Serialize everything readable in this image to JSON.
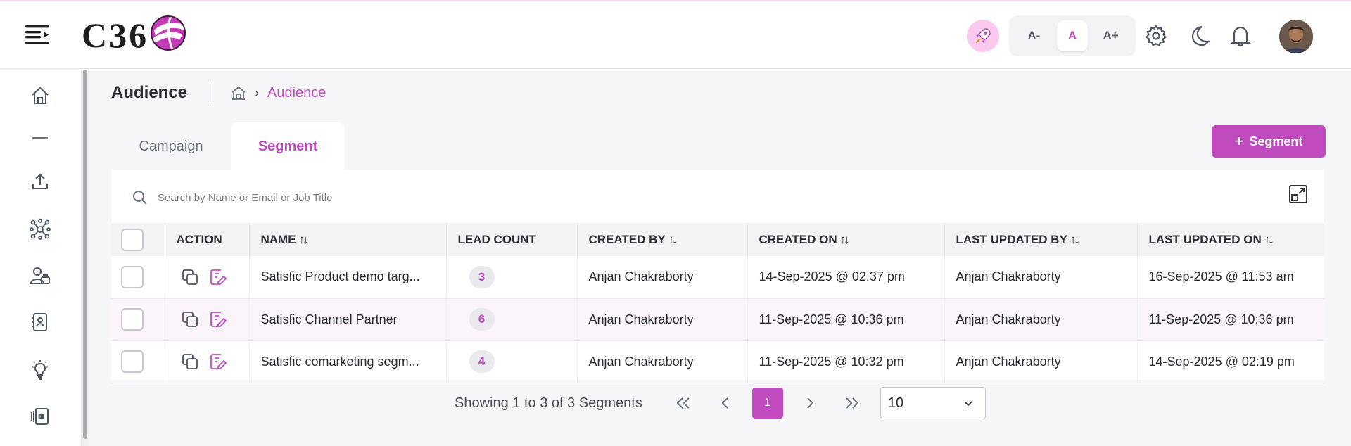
{
  "header": {
    "logo_text": "C36",
    "font_sizes": [
      "A-",
      "A",
      "A+"
    ],
    "active_font_size": "A"
  },
  "page": {
    "title": "Audience",
    "breadcrumb_current": "Audience"
  },
  "tabs": [
    {
      "label": "Campaign",
      "active": false
    },
    {
      "label": "Segment",
      "active": true
    }
  ],
  "add_button_label": "Segment",
  "search": {
    "placeholder": "Search by Name or Email or Job Title"
  },
  "table": {
    "columns": [
      "ACTION",
      "NAME",
      "LEAD COUNT",
      "CREATED BY",
      "CREATED ON",
      "LAST UPDATED BY",
      "LAST UPDATED ON"
    ],
    "rows": [
      {
        "name": "Satisfic Product demo targ...",
        "lead_count": "3",
        "created_by": "Anjan Chakraborty",
        "created_on": "14-Sep-2025 @ 02:37 pm",
        "updated_by": "Anjan Chakraborty",
        "updated_on": "16-Sep-2025 @ 11:53 am"
      },
      {
        "name": "Satisfic Channel Partner",
        "lead_count": "6",
        "created_by": "Anjan Chakraborty",
        "created_on": "11-Sep-2025 @ 10:36 pm",
        "updated_by": "Anjan Chakraborty",
        "updated_on": "11-Sep-2025 @ 10:36 pm"
      },
      {
        "name": "Satisfic comarketing segm...",
        "lead_count": "4",
        "created_by": "Anjan Chakraborty",
        "created_on": "11-Sep-2025 @ 10:32 pm",
        "updated_by": "Anjan Chakraborty",
        "updated_on": "14-Sep-2025 @ 02:19 pm"
      }
    ]
  },
  "pagination": {
    "showing": "Showing 1 to 3 of 3 Segments",
    "current_page": "1",
    "page_size": "10"
  },
  "colors": {
    "accent": "#c04bbf",
    "rocket_bg": "#f9c9ef"
  },
  "icons": {
    "header": [
      "menu-icon",
      "rocket-icon",
      "gear-icon",
      "moon-icon",
      "bell-icon"
    ],
    "sidebar": [
      "home-icon",
      "dash-icon",
      "upload-icon",
      "network-icon",
      "user-group-icon",
      "contact-card-icon",
      "lightbulb-icon",
      "card-stack-icon"
    ]
  }
}
